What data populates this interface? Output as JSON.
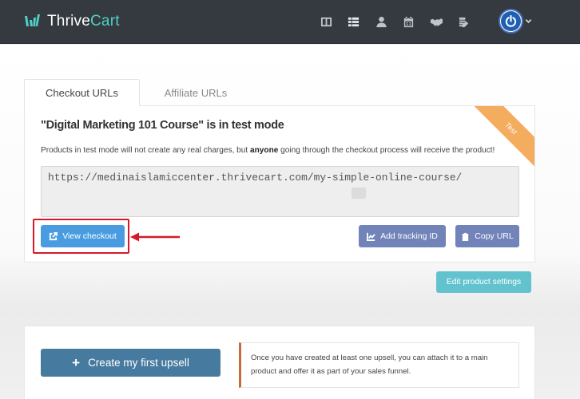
{
  "app": {
    "name_part1": "Thrive",
    "name_part2": "Cart"
  },
  "nav": {
    "icons": [
      "columns-icon",
      "list-icon",
      "user-icon",
      "calendar-icon",
      "handshake-icon",
      "edit-doc-icon"
    ]
  },
  "tabs": [
    {
      "label": "Checkout URLs",
      "active": true
    },
    {
      "label": "Affiliate URLs",
      "active": false
    }
  ],
  "card": {
    "title": "\"Digital Marketing 101 Course\" is in test mode",
    "ribbon": "Test",
    "desc_before": "Products in test mode will not create any real charges, but ",
    "desc_bold": "anyone",
    "desc_after": " going through the checkout process will receive the product!",
    "url": "https://medinaislamiccenter.thrivecart.com/my-simple-online-course/"
  },
  "buttons": {
    "view_checkout": "View checkout",
    "add_tracking": "Add tracking ID",
    "copy_url": "Copy URL",
    "edit_product": "Edit product settings",
    "create_upsell": "Create my first upsell",
    "create_upsell_icon": "+"
  },
  "upsell_note": "Once you have created at least one upsell, you can attach it to a main product and offer it as part of your sales funnel.",
  "colors": {
    "topbar": "#353a40",
    "accent_teal": "#4fd1c5",
    "view_button": "#4a9ce0",
    "secondary_button": "#7183b8",
    "edit_button": "#62c3cf",
    "upsell_button": "#477a9f",
    "ribbon": "#f4ad5e",
    "highlight": "#d6182a"
  }
}
